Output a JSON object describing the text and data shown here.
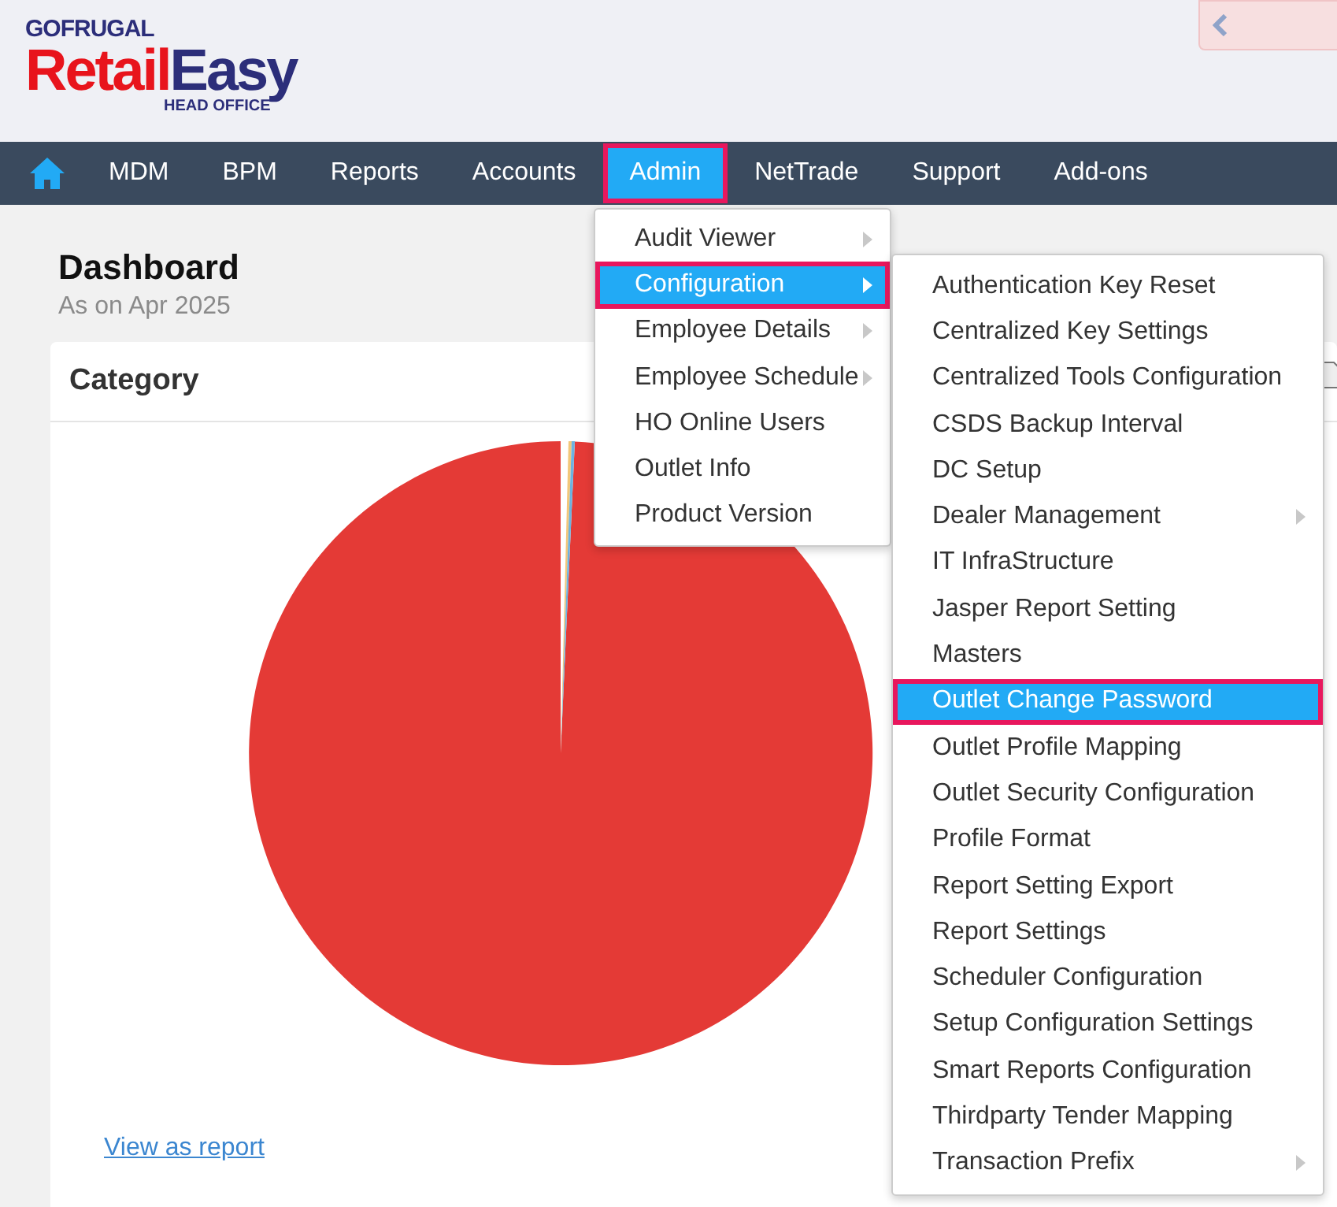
{
  "logo": {
    "brand": "GOFRUGAL",
    "name_first": "Retail",
    "name_second": "Easy",
    "subtitle": "HEAD OFFICE"
  },
  "nav": [
    {
      "label": "MDM",
      "selected": false,
      "highlighted": false
    },
    {
      "label": "BPM",
      "selected": false,
      "highlighted": false
    },
    {
      "label": "Reports",
      "selected": false,
      "highlighted": false
    },
    {
      "label": "Accounts",
      "selected": false,
      "highlighted": false
    },
    {
      "label": "Admin",
      "selected": true,
      "highlighted": true
    },
    {
      "label": "NetTrade",
      "selected": false,
      "highlighted": false
    },
    {
      "label": "Support",
      "selected": false,
      "highlighted": false
    },
    {
      "label": "Add-ons",
      "selected": false,
      "highlighted": false
    }
  ],
  "dashboard": {
    "title": "Dashboard",
    "subtitle": "As on Apr 2025"
  },
  "card": {
    "title": "Category",
    "link": "View as report"
  },
  "admin_menu": [
    {
      "label": "Audit Viewer",
      "has_submenu": true,
      "selected": false,
      "highlighted": false
    },
    {
      "label": "Configuration",
      "has_submenu": true,
      "selected": true,
      "highlighted": true
    },
    {
      "label": "Employee Details",
      "has_submenu": true,
      "selected": false,
      "highlighted": false
    },
    {
      "label": "Employee Schedule",
      "has_submenu": true,
      "selected": false,
      "highlighted": false
    },
    {
      "label": "HO Online Users",
      "has_submenu": false,
      "selected": false,
      "highlighted": false
    },
    {
      "label": "Outlet Info",
      "has_submenu": false,
      "selected": false,
      "highlighted": false
    },
    {
      "label": "Product Version",
      "has_submenu": false,
      "selected": false,
      "highlighted": false
    }
  ],
  "configuration_menu": [
    {
      "label": "Authentication Key Reset",
      "has_submenu": false,
      "selected": false,
      "highlighted": false
    },
    {
      "label": "Centralized Key Settings",
      "has_submenu": false,
      "selected": false,
      "highlighted": false
    },
    {
      "label": "Centralized Tools Configuration",
      "has_submenu": false,
      "selected": false,
      "highlighted": false
    },
    {
      "label": "CSDS Backup Interval",
      "has_submenu": false,
      "selected": false,
      "highlighted": false
    },
    {
      "label": "DC Setup",
      "has_submenu": false,
      "selected": false,
      "highlighted": false
    },
    {
      "label": "Dealer Management",
      "has_submenu": true,
      "selected": false,
      "highlighted": false
    },
    {
      "label": "IT InfraStructure",
      "has_submenu": false,
      "selected": false,
      "highlighted": false
    },
    {
      "label": "Jasper Report Setting",
      "has_submenu": false,
      "selected": false,
      "highlighted": false
    },
    {
      "label": "Masters",
      "has_submenu": false,
      "selected": false,
      "highlighted": false
    },
    {
      "label": "Outlet Change Password",
      "has_submenu": false,
      "selected": true,
      "highlighted": true
    },
    {
      "label": "Outlet Profile Mapping",
      "has_submenu": false,
      "selected": false,
      "highlighted": false
    },
    {
      "label": "Outlet Security Configuration",
      "has_submenu": false,
      "selected": false,
      "highlighted": false
    },
    {
      "label": "Profile Format",
      "has_submenu": false,
      "selected": false,
      "highlighted": false
    },
    {
      "label": "Report Setting Export",
      "has_submenu": false,
      "selected": false,
      "highlighted": false
    },
    {
      "label": "Report Settings",
      "has_submenu": false,
      "selected": false,
      "highlighted": false
    },
    {
      "label": "Scheduler Configuration",
      "has_submenu": false,
      "selected": false,
      "highlighted": false
    },
    {
      "label": "Setup Configuration Settings",
      "has_submenu": false,
      "selected": false,
      "highlighted": false
    },
    {
      "label": "Smart Reports Configuration",
      "has_submenu": false,
      "selected": false,
      "highlighted": false
    },
    {
      "label": "Thirdparty Tender Mapping",
      "has_submenu": false,
      "selected": false,
      "highlighted": false
    },
    {
      "label": "Transaction Prefix",
      "has_submenu": true,
      "selected": false,
      "highlighted": false
    }
  ]
}
